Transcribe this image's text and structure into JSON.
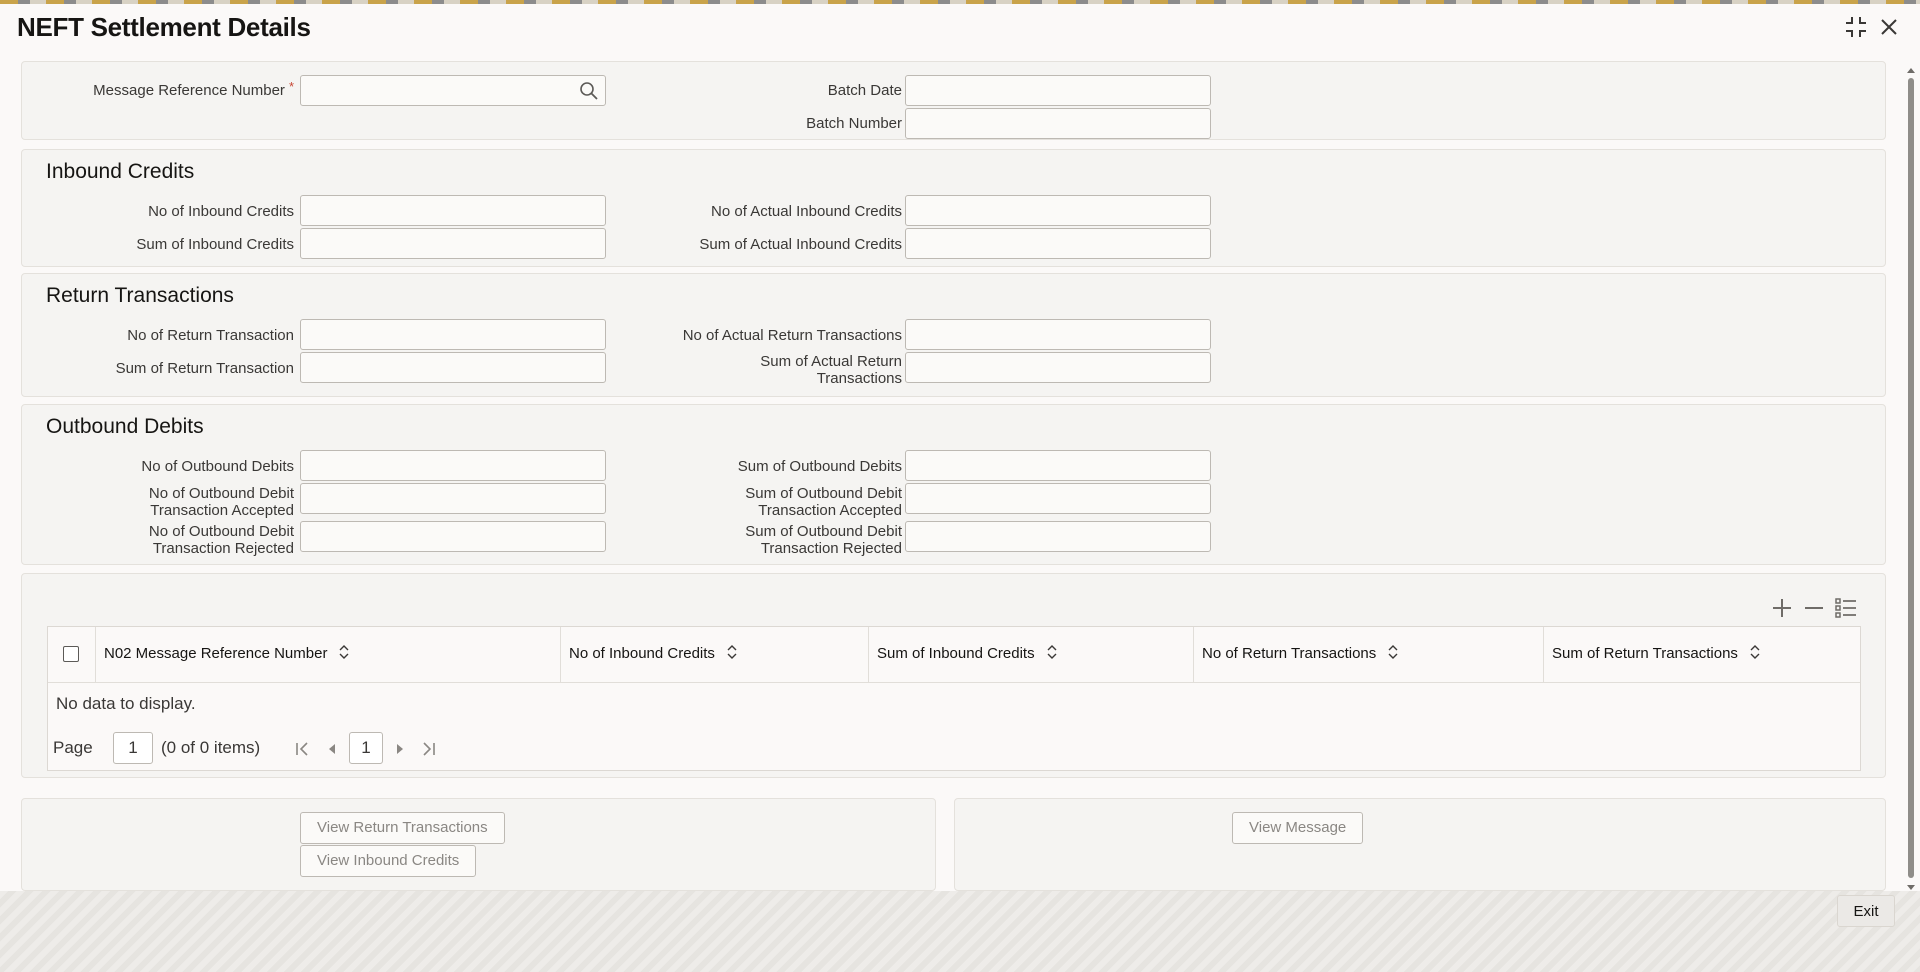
{
  "window": {
    "title": "NEFT Settlement Details",
    "maximize_icon": "maximize-icon",
    "close_icon": "close-icon"
  },
  "header": {
    "message_reference_label": "Message Reference Number",
    "required_mark": "*",
    "message_reference_value": "",
    "batch_date_label": "Batch Date",
    "batch_date_value": "",
    "batch_number_label": "Batch Number",
    "batch_number_value": ""
  },
  "inbound": {
    "title": "Inbound Credits",
    "no_label": "No of Inbound Credits",
    "sum_label": "Sum of Inbound Credits",
    "no_actual_label": "No of Actual Inbound Credits",
    "sum_actual_label": "Sum of Actual Inbound Credits"
  },
  "returns": {
    "title": "Return Transactions",
    "no_label": "No of Return Transaction",
    "sum_label": "Sum of Return Transaction",
    "no_actual_label": "No of Actual Return Transactions",
    "sum_actual_label_1": "Sum of Actual Return",
    "sum_actual_label_2": "Transactions"
  },
  "outbound": {
    "title": "Outbound Debits",
    "no_label": "No of Outbound Debits",
    "sum_label": "Sum of Outbound Debits",
    "no_accepted_1": "No of Outbound Debit",
    "no_accepted_2": "Transaction Accepted",
    "sum_accepted_1": "Sum of Outbound Debit",
    "sum_accepted_2": "Transaction Accepted",
    "no_rejected_1": "No of Outbound Debit",
    "no_rejected_2": "Transaction Rejected",
    "sum_rejected_1": "Sum of Outbound Debit",
    "sum_rejected_2": "Transaction Rejected"
  },
  "grid": {
    "columns": [
      "N02 Message Reference Number",
      "No of Inbound Credits",
      "Sum of Inbound Credits",
      "No of Return Transactions",
      "Sum of Return Transactions"
    ],
    "no_data": "No data to display.",
    "page_label": "Page",
    "page_value": "1",
    "items_text": "(0 of 0 items)",
    "current_page": "1"
  },
  "buttons": {
    "view_return": "View Return Transactions",
    "view_inbound": "View Inbound Credits",
    "view_message": "View Message",
    "exit": "Exit"
  }
}
